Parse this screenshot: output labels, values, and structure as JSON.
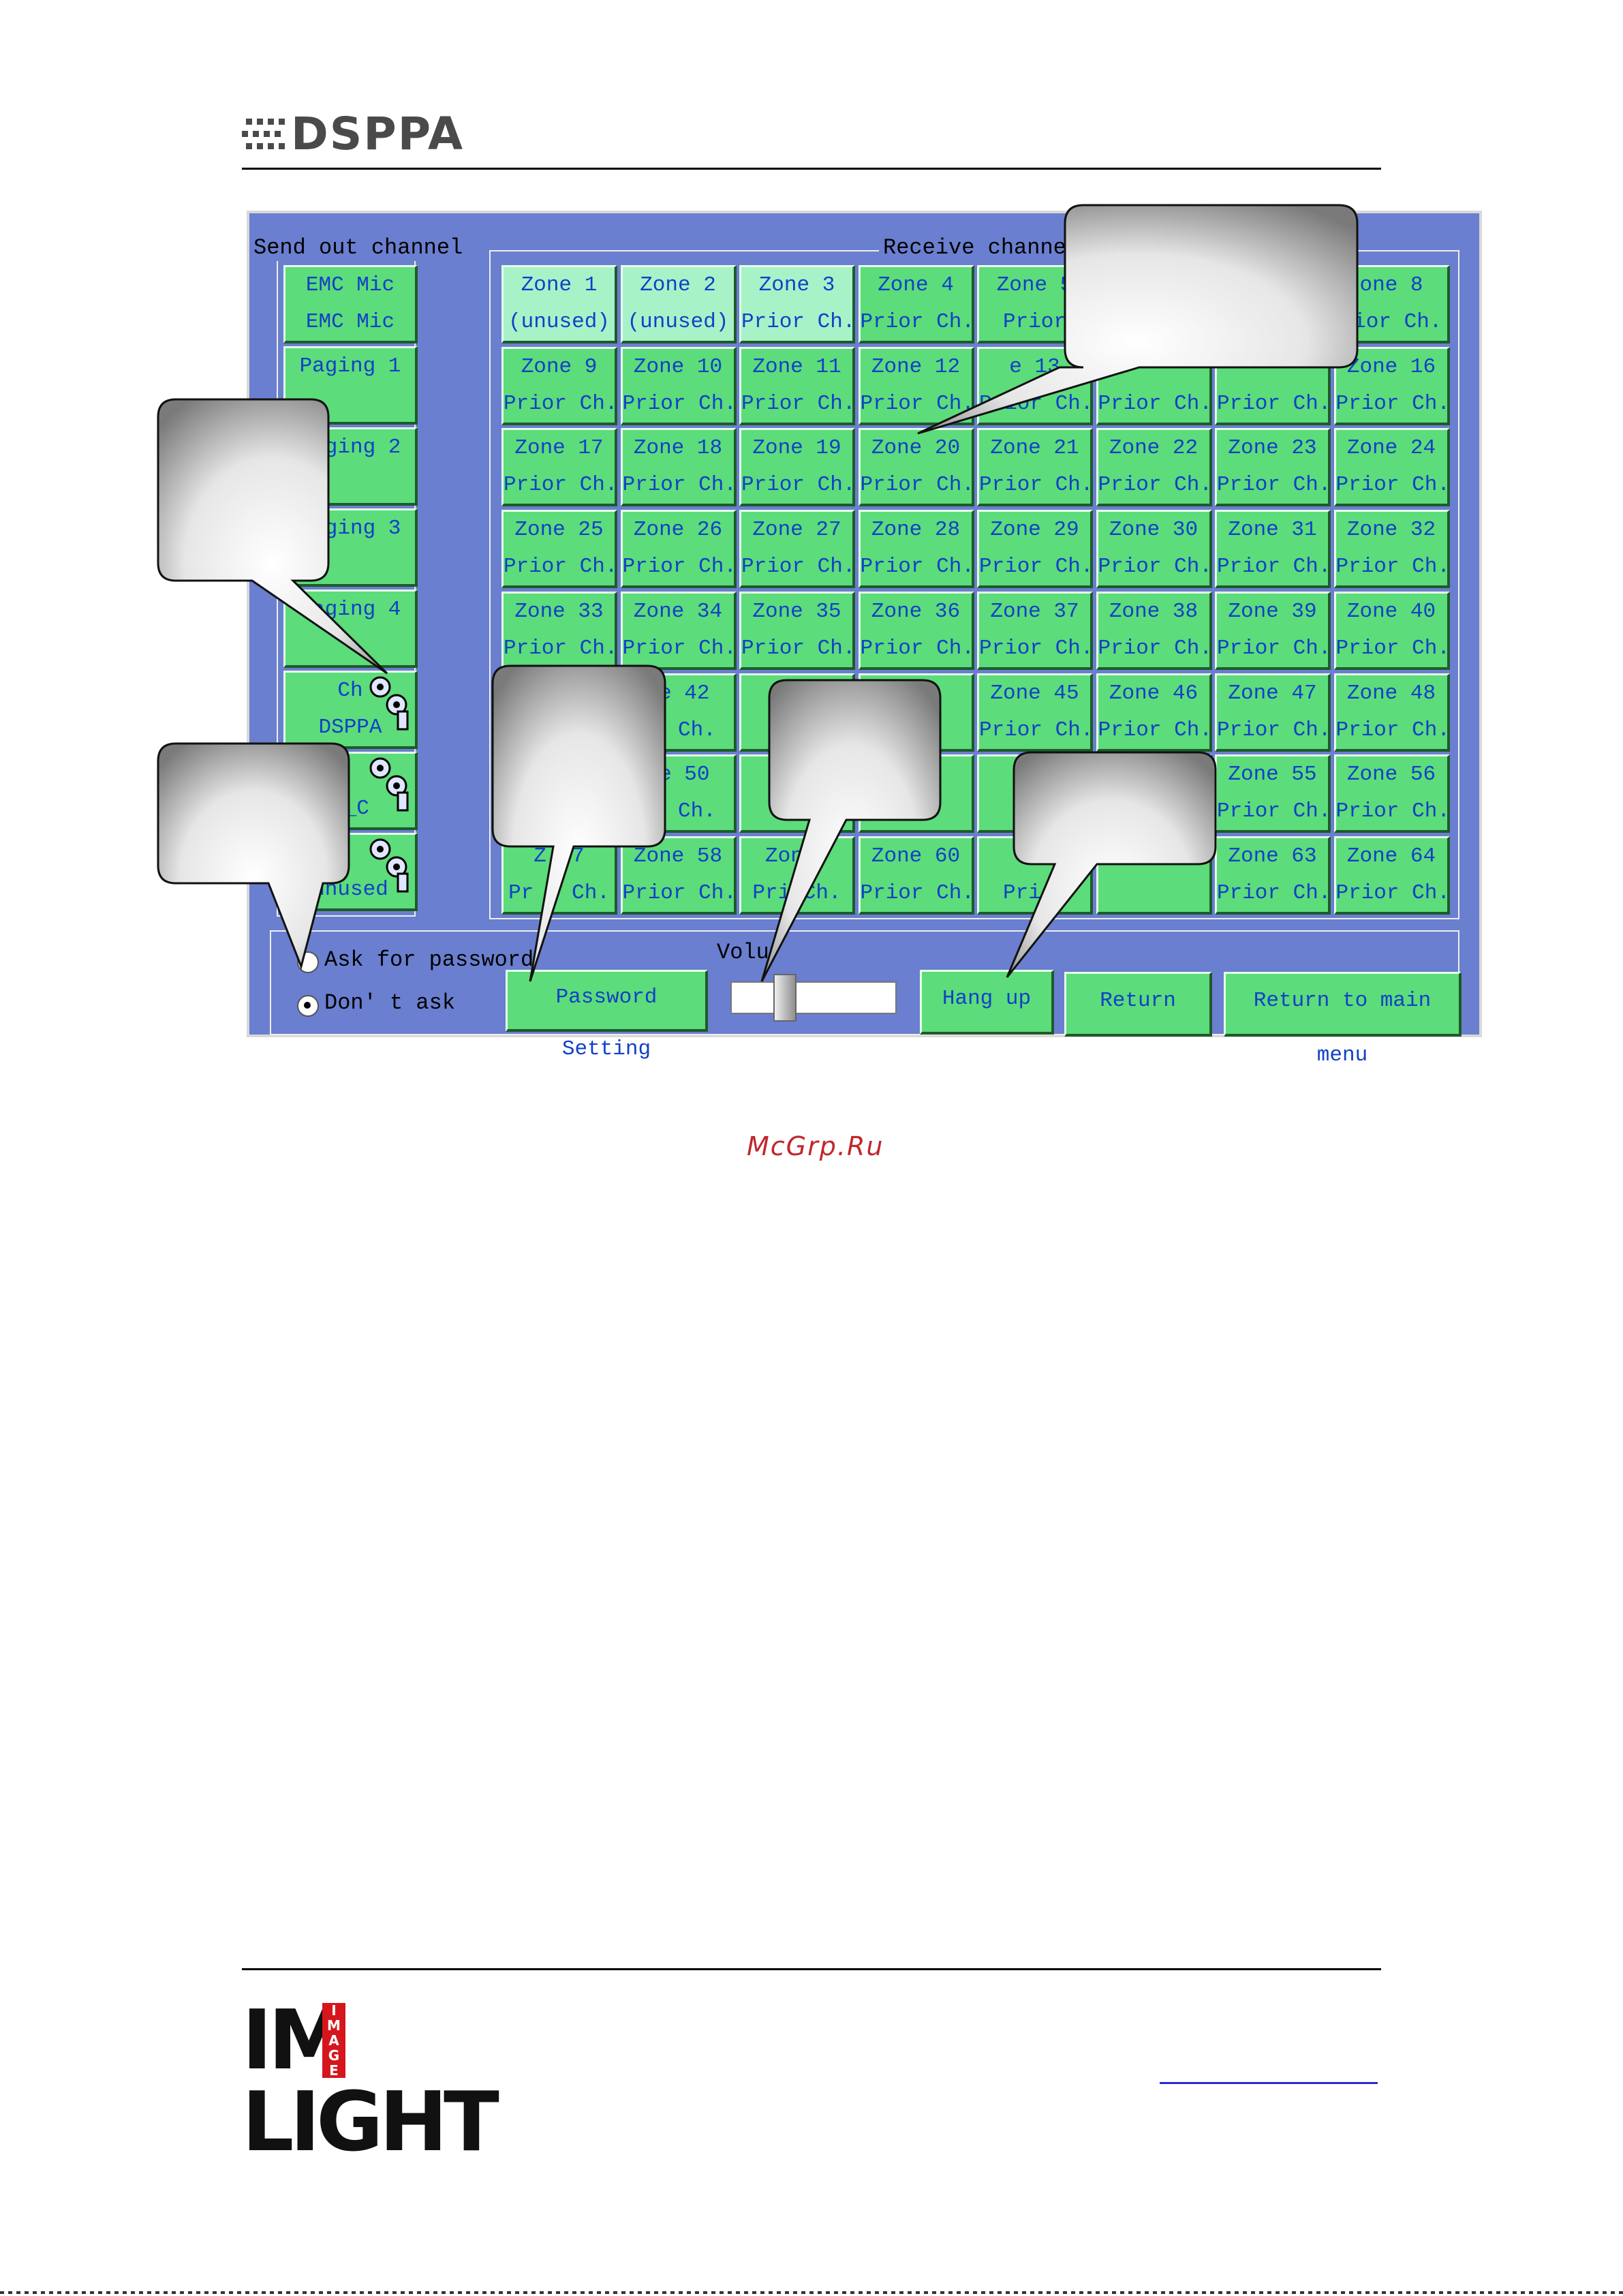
{
  "header": {
    "brand": "DSPPA"
  },
  "send_panel": {
    "title": "Send out channel",
    "items": [
      {
        "label": "EMC Mic\nEMC Mic"
      },
      {
        "label": "Paging 1\n"
      },
      {
        "label": "Paging 2\n"
      },
      {
        "label": "Paging 3\n"
      },
      {
        "label": "Paging 4\n"
      },
      {
        "label": "Ch\nDSPPA"
      },
      {
        "label": "\nC_C"
      },
      {
        "label": "\nunused"
      }
    ]
  },
  "receive_panel": {
    "title": "Receive channel",
    "zones": [
      "Zone 1\n(unused)",
      "Zone 2\n(unused)",
      "Zone 3\nPrior Ch.",
      "Zone 4\nPrior Ch.",
      "Zone 5\nPrior",
      "",
      "",
      "one 8\nrior Ch.",
      "Zone 9\nPrior Ch.",
      "Zone 10\nPrior Ch.",
      "Zone 11\nPrior Ch.",
      "Zone 12\nPrior Ch.",
      "e 13\nPrior Ch.",
      "\nPrior Ch.",
      "\nPrior Ch.",
      "Zone 16\nPrior Ch.",
      "Zone 17\nPrior Ch.",
      "Zone 18\nPrior Ch.",
      "Zone 19\nPrior Ch.",
      "Zone 20\nPrior Ch.",
      "Zone 21\nPrior Ch.",
      "Zone 22\nPrior Ch.",
      "Zone 23\nPrior Ch.",
      "Zone 24\nPrior Ch.",
      "Zone 25\nPrior Ch.",
      "Zone 26\nPrior Ch.",
      "Zone 27\nPrior Ch.",
      "Zone 28\nPrior Ch.",
      "Zone 29\nPrior Ch.",
      "Zone 30\nPrior Ch.",
      "Zone 31\nPrior Ch.",
      "Zone 32\nPrior Ch.",
      "Zone 33\nPrior Ch.",
      "Zone 34\nPrior Ch.",
      "Zone 35\nPrior Ch.",
      "Zone 36\nPrior Ch.",
      "Zone 37\nPrior Ch.",
      "Zone 38\nPrior Ch.",
      "Zone 39\nPrior Ch.",
      "Zone 40\nPrior Ch.",
      "\n",
      "ne 42\nor Ch.",
      "Zo\nPri",
      "44\nh.",
      "Zone 45\nPrior Ch.",
      "Zone 46\nPrior Ch.",
      "Zone 47\nPrior Ch.",
      "Zone 48\nPrior Ch.",
      "\n",
      "ne 50\nor Ch.",
      "Z\nPri",
      "2\nh.",
      "Zo\nPri",
      "\n",
      "Zone 55\nPrior Ch.",
      "Zone 56\nPrior Ch.",
      "Z 57\nPr r Ch.",
      "Zone 58\nPrior Ch.",
      "Zon 9\nPri Ch.",
      "Zone 60\nPrior Ch.",
      "Zo\nPrior",
      "\n",
      "Zone 63\nPrior Ch.",
      "Zone 64\nPrior Ch."
    ]
  },
  "controls": {
    "ask_password": "Ask for password",
    "dont_ask": "Don' t ask",
    "password_setting": "Password Setting",
    "volume_label": "Volu",
    "volume_level": 0.3,
    "hang_up": "Hang up",
    "return": "Return",
    "return_main": "Return to main menu"
  },
  "watermark": "McGrp.Ru",
  "footer": {
    "logo_main": "IM LIGHT",
    "logo_badge": "IMAGE"
  },
  "colors": {
    "window_bg": "#6a7fcf",
    "button_green": "#5cdc7a",
    "button_light": "#a8f2c8",
    "button_text": "#1240c8",
    "watermark": "#c0272d"
  }
}
